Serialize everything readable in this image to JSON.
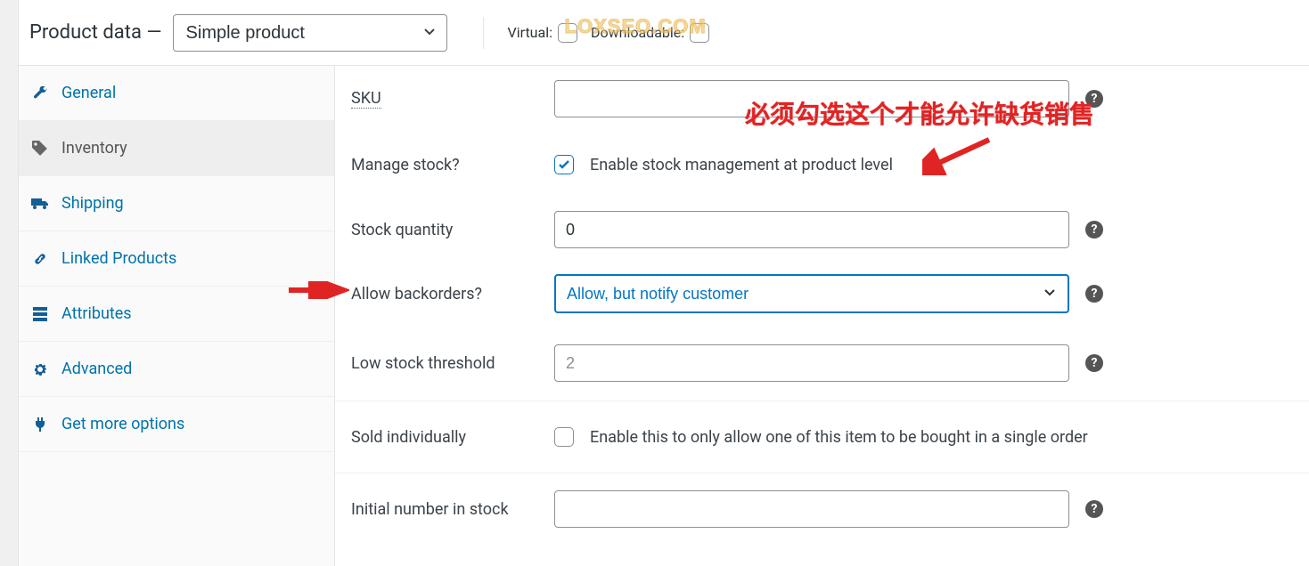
{
  "header": {
    "title": "Product data —",
    "product_type": "Simple product",
    "virtual_label": "Virtual:",
    "downloadable_label": "Downloadable:",
    "watermark": "LOXSEO.COM"
  },
  "tabs": [
    {
      "id": "general",
      "label": "General"
    },
    {
      "id": "inventory",
      "label": "Inventory"
    },
    {
      "id": "shipping",
      "label": "Shipping"
    },
    {
      "id": "linked",
      "label": "Linked Products"
    },
    {
      "id": "attributes",
      "label": "Attributes"
    },
    {
      "id": "advanced",
      "label": "Advanced"
    },
    {
      "id": "more",
      "label": "Get more options"
    }
  ],
  "active_tab": "inventory",
  "fields": {
    "sku": {
      "label": "SKU",
      "value": ""
    },
    "manage_stock": {
      "label": "Manage stock?",
      "checked": true,
      "text": "Enable stock management at product level"
    },
    "stock_qty": {
      "label": "Stock quantity",
      "value": "0"
    },
    "backorders": {
      "label": "Allow backorders?",
      "value": "Allow, but notify customer"
    },
    "low_stock": {
      "label": "Low stock threshold",
      "placeholder": "2",
      "value": ""
    },
    "sold_individually": {
      "label": "Sold individually",
      "checked": false,
      "text": "Enable this to only allow one of this item to be bought in a single order"
    },
    "initial_stock": {
      "label": "Initial number in stock",
      "value": ""
    }
  },
  "annotations": {
    "top_text": "必须勾选这个才能允许缺货销售"
  }
}
